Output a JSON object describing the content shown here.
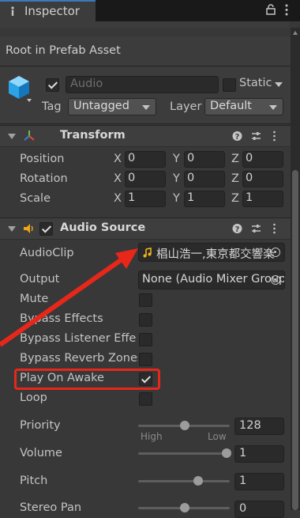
{
  "window": {
    "tab_label": "Inspector"
  },
  "breadcrumb": "Root in Prefab Asset",
  "object": {
    "name_placeholder": "Audio",
    "active": true,
    "static_label": "Static",
    "static_checked": false,
    "tag_label": "Tag",
    "tag_value": "Untagged",
    "layer_label": "Layer",
    "layer_value": "Default"
  },
  "transform": {
    "title": "Transform",
    "axes": [
      "X",
      "Y",
      "Z"
    ],
    "position": {
      "label": "Position",
      "x": "0",
      "y": "0",
      "z": "0"
    },
    "rotation": {
      "label": "Rotation",
      "x": "0",
      "y": "0",
      "z": "0"
    },
    "scale": {
      "label": "Scale",
      "x": "1",
      "y": "1",
      "z": "1"
    }
  },
  "audio_source": {
    "title": "Audio Source",
    "enabled": true,
    "audio_clip": {
      "label": "AudioClip",
      "value": "椙山浩一,東京都交響楽"
    },
    "output": {
      "label": "Output",
      "value": "None (Audio Mixer Group)"
    },
    "mute": {
      "label": "Mute",
      "checked": false
    },
    "bypass_effects": {
      "label": "Bypass Effects",
      "checked": false
    },
    "bypass_listener": {
      "label": "Bypass Listener Effects",
      "checked": false
    },
    "bypass_reverb": {
      "label": "Bypass Reverb Zones",
      "checked": false
    },
    "play_on_awake": {
      "label": "Play On Awake",
      "checked": true
    },
    "loop": {
      "label": "Loop",
      "checked": false
    },
    "priority": {
      "label": "Priority",
      "value": "128",
      "high_label": "High",
      "low_label": "Low"
    },
    "volume": {
      "label": "Volume",
      "value": "1"
    },
    "pitch": {
      "label": "Pitch",
      "value": "1"
    },
    "stereo_pan": {
      "label": "Stereo Pan",
      "value": "0"
    }
  },
  "colors": {
    "annotation": "#e8271b",
    "accent": "#3a79bb",
    "panel": "#383838"
  }
}
